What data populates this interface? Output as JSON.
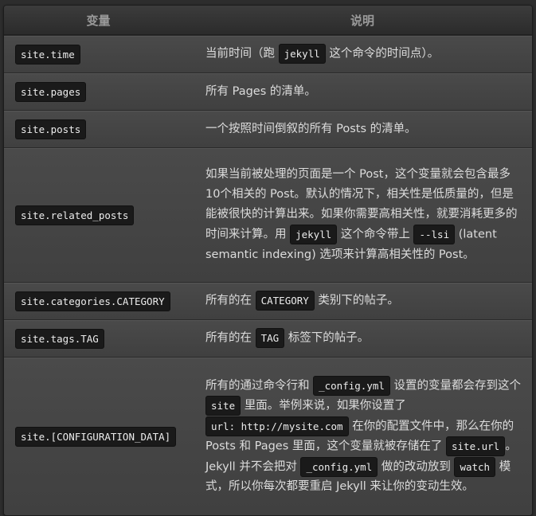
{
  "header": {
    "col_var": "变量",
    "col_desc": "说明"
  },
  "rows": [
    {
      "var": "site.time",
      "d": [
        "当前时间（跑 ",
        "jekyll",
        " 这个命令的时间点）。"
      ]
    },
    {
      "var": "site.pages",
      "d": [
        "所有 Pages 的清单。"
      ]
    },
    {
      "var": "site.posts",
      "d": [
        "一个按照时间倒叙的所有 Posts 的清单。"
      ]
    },
    {
      "var": "site.related_posts",
      "d": [
        "如果当前被处理的页面是一个 Post，这个变量就会包含最多10个相关的 Post。默认的情况下，相关性是低质量的，但是能被很快的计算出来。如果你需要高相关性，就要消耗更多的时间来计算。用 ",
        "jekyll",
        " 这个命令带上 ",
        "--lsi",
        " (latent semantic indexing) 选项来计算高相关性的 Post。"
      ]
    },
    {
      "var": "site.categories.CATEGORY",
      "d": [
        "所有的在 ",
        "CATEGORY",
        " 类别下的帖子。"
      ]
    },
    {
      "var": "site.tags.TAG",
      "d": [
        "所有的在 ",
        "TAG",
        " 标签下的帖子。"
      ]
    },
    {
      "var": "site.[CONFIGURATION_DATA]",
      "d": [
        "所有的通过命令行和 ",
        "_config.yml",
        " 设置的变量都会存到这个 ",
        "site",
        " 里面。举例来说，如果你设置了 ",
        "url: http://mysite.com",
        " 在你的配置文件中，那么在你的 Posts 和 Pages 里面，这个变量就被存储在了 ",
        "site.url",
        "。Jekyll 并不会把对 ",
        "_config.yml",
        " 做的改动放到 ",
        "watch",
        " 模式，所以你每次都要重启 Jekyll 来让你的变动生效。"
      ]
    }
  ]
}
